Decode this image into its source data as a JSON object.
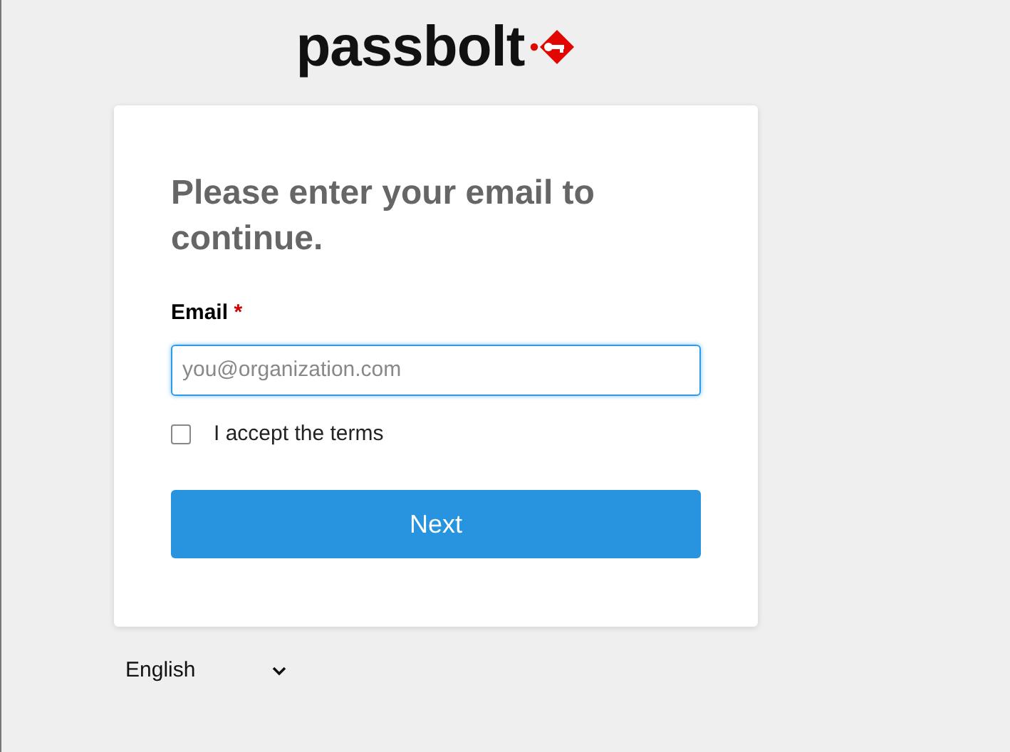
{
  "logo": {
    "text": "passbolt"
  },
  "form": {
    "title": "Please enter your email to continue.",
    "email": {
      "label": "Email",
      "required_mark": "*",
      "placeholder": "you@organization.com",
      "focused": true
    },
    "terms": {
      "label": "I accept the terms",
      "checked": false
    },
    "button": "Next"
  },
  "language": {
    "value": "English"
  }
}
